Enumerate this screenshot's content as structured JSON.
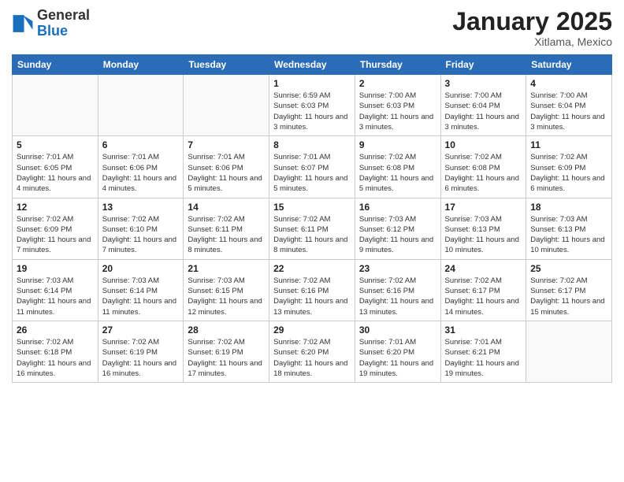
{
  "header": {
    "logo_general": "General",
    "logo_blue": "Blue",
    "title": "January 2025",
    "subtitle": "Xitlama, Mexico"
  },
  "days_of_week": [
    "Sunday",
    "Monday",
    "Tuesday",
    "Wednesday",
    "Thursday",
    "Friday",
    "Saturday"
  ],
  "weeks": [
    [
      {
        "day": "",
        "info": ""
      },
      {
        "day": "",
        "info": ""
      },
      {
        "day": "",
        "info": ""
      },
      {
        "day": "1",
        "info": "Sunrise: 6:59 AM\nSunset: 6:03 PM\nDaylight: 11 hours and 3 minutes."
      },
      {
        "day": "2",
        "info": "Sunrise: 7:00 AM\nSunset: 6:03 PM\nDaylight: 11 hours and 3 minutes."
      },
      {
        "day": "3",
        "info": "Sunrise: 7:00 AM\nSunset: 6:04 PM\nDaylight: 11 hours and 3 minutes."
      },
      {
        "day": "4",
        "info": "Sunrise: 7:00 AM\nSunset: 6:04 PM\nDaylight: 11 hours and 3 minutes."
      }
    ],
    [
      {
        "day": "5",
        "info": "Sunrise: 7:01 AM\nSunset: 6:05 PM\nDaylight: 11 hours and 4 minutes."
      },
      {
        "day": "6",
        "info": "Sunrise: 7:01 AM\nSunset: 6:06 PM\nDaylight: 11 hours and 4 minutes."
      },
      {
        "day": "7",
        "info": "Sunrise: 7:01 AM\nSunset: 6:06 PM\nDaylight: 11 hours and 5 minutes."
      },
      {
        "day": "8",
        "info": "Sunrise: 7:01 AM\nSunset: 6:07 PM\nDaylight: 11 hours and 5 minutes."
      },
      {
        "day": "9",
        "info": "Sunrise: 7:02 AM\nSunset: 6:08 PM\nDaylight: 11 hours and 5 minutes."
      },
      {
        "day": "10",
        "info": "Sunrise: 7:02 AM\nSunset: 6:08 PM\nDaylight: 11 hours and 6 minutes."
      },
      {
        "day": "11",
        "info": "Sunrise: 7:02 AM\nSunset: 6:09 PM\nDaylight: 11 hours and 6 minutes."
      }
    ],
    [
      {
        "day": "12",
        "info": "Sunrise: 7:02 AM\nSunset: 6:09 PM\nDaylight: 11 hours and 7 minutes."
      },
      {
        "day": "13",
        "info": "Sunrise: 7:02 AM\nSunset: 6:10 PM\nDaylight: 11 hours and 7 minutes."
      },
      {
        "day": "14",
        "info": "Sunrise: 7:02 AM\nSunset: 6:11 PM\nDaylight: 11 hours and 8 minutes."
      },
      {
        "day": "15",
        "info": "Sunrise: 7:02 AM\nSunset: 6:11 PM\nDaylight: 11 hours and 8 minutes."
      },
      {
        "day": "16",
        "info": "Sunrise: 7:03 AM\nSunset: 6:12 PM\nDaylight: 11 hours and 9 minutes."
      },
      {
        "day": "17",
        "info": "Sunrise: 7:03 AM\nSunset: 6:13 PM\nDaylight: 11 hours and 10 minutes."
      },
      {
        "day": "18",
        "info": "Sunrise: 7:03 AM\nSunset: 6:13 PM\nDaylight: 11 hours and 10 minutes."
      }
    ],
    [
      {
        "day": "19",
        "info": "Sunrise: 7:03 AM\nSunset: 6:14 PM\nDaylight: 11 hours and 11 minutes."
      },
      {
        "day": "20",
        "info": "Sunrise: 7:03 AM\nSunset: 6:14 PM\nDaylight: 11 hours and 11 minutes."
      },
      {
        "day": "21",
        "info": "Sunrise: 7:03 AM\nSunset: 6:15 PM\nDaylight: 11 hours and 12 minutes."
      },
      {
        "day": "22",
        "info": "Sunrise: 7:02 AM\nSunset: 6:16 PM\nDaylight: 11 hours and 13 minutes."
      },
      {
        "day": "23",
        "info": "Sunrise: 7:02 AM\nSunset: 6:16 PM\nDaylight: 11 hours and 13 minutes."
      },
      {
        "day": "24",
        "info": "Sunrise: 7:02 AM\nSunset: 6:17 PM\nDaylight: 11 hours and 14 minutes."
      },
      {
        "day": "25",
        "info": "Sunrise: 7:02 AM\nSunset: 6:17 PM\nDaylight: 11 hours and 15 minutes."
      }
    ],
    [
      {
        "day": "26",
        "info": "Sunrise: 7:02 AM\nSunset: 6:18 PM\nDaylight: 11 hours and 16 minutes."
      },
      {
        "day": "27",
        "info": "Sunrise: 7:02 AM\nSunset: 6:19 PM\nDaylight: 11 hours and 16 minutes."
      },
      {
        "day": "28",
        "info": "Sunrise: 7:02 AM\nSunset: 6:19 PM\nDaylight: 11 hours and 17 minutes."
      },
      {
        "day": "29",
        "info": "Sunrise: 7:02 AM\nSunset: 6:20 PM\nDaylight: 11 hours and 18 minutes."
      },
      {
        "day": "30",
        "info": "Sunrise: 7:01 AM\nSunset: 6:20 PM\nDaylight: 11 hours and 19 minutes."
      },
      {
        "day": "31",
        "info": "Sunrise: 7:01 AM\nSunset: 6:21 PM\nDaylight: 11 hours and 19 minutes."
      },
      {
        "day": "",
        "info": ""
      }
    ]
  ]
}
